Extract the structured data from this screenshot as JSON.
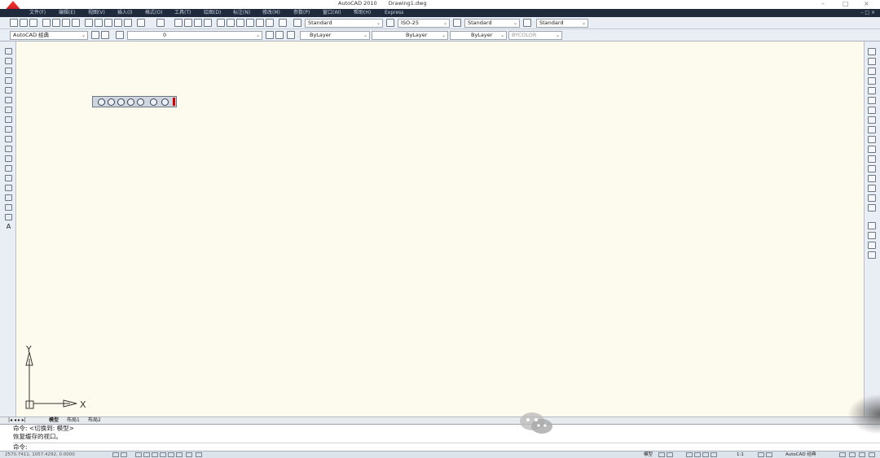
{
  "window": {
    "app": "AutoCAD 2010",
    "file": "Drawing1.dwg",
    "minimize": "–",
    "maximize": "□",
    "close": "×"
  },
  "menu": [
    "文件(F)",
    "编辑(E)",
    "视图(V)",
    "插入(I)",
    "格式(O)",
    "工具(T)",
    "绘图(D)",
    "标注(N)",
    "修改(M)",
    "参数(P)",
    "窗口(W)",
    "帮助(H)",
    "Express"
  ],
  "mdi_controls": "– □ ×",
  "styles": {
    "text_style": "Standard",
    "dim_style": "ISO-25",
    "table_style": "Standard",
    "mleader_style": "Standard"
  },
  "workspace": "AutoCAD 经典",
  "layer": {
    "current": "0"
  },
  "properties": {
    "color": "ByLayer",
    "linetype": "ByLayer",
    "lineweight": "ByLayer",
    "plotstyle": "BYCOLOR"
  },
  "ucs": {
    "y_label": "Y",
    "x_label": "X"
  },
  "tabs": {
    "nav": "|◂ ◂ ▸ ▸|",
    "model": "模型",
    "layout1": "布局1",
    "layout2": "布局2"
  },
  "command": {
    "line1": "命令:  <切换到: 模型>",
    "line2": "恢复缓存的视口。",
    "prompt": "命令:"
  },
  "status": {
    "coords": "2570.7411, 1057.4292, 0.0000",
    "model": "模型",
    "annotation_scale": "1:1",
    "workspace_label": "AutoCAD 经典"
  }
}
